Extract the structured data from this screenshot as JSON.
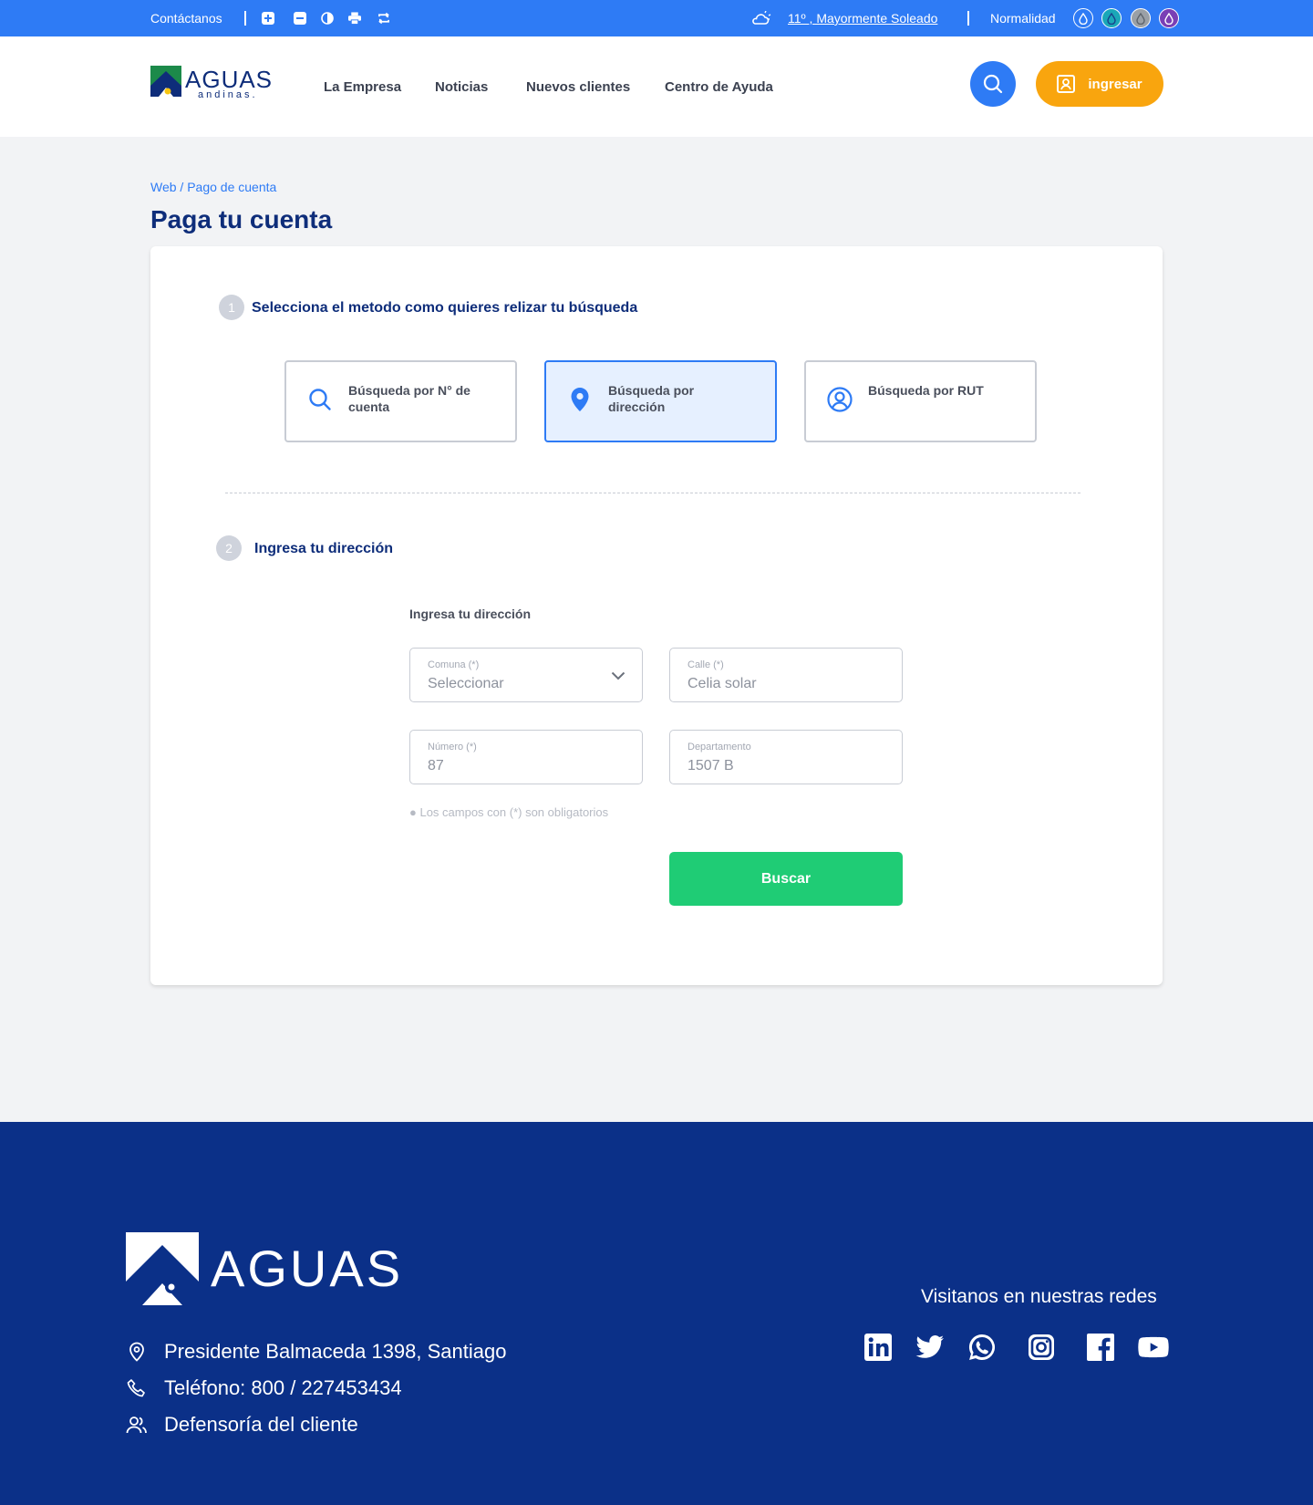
{
  "topbar": {
    "contact": "Contáctanos",
    "weather": "11º , Mayormente Soleado",
    "status": "Normalidad",
    "drop_colors": [
      "#2e7bf5",
      "#1aa7b8",
      "#9aa0a6",
      "#7a3fb5"
    ]
  },
  "brand": {
    "name": "AGUAS",
    "sub": "andinas."
  },
  "nav": {
    "items": [
      "La Empresa",
      "Noticias",
      "Nuevos clientes",
      "Centro de Ayuda"
    ],
    "login": "ingresar"
  },
  "breadcrumb": "Web / Pago de cuenta",
  "page_title": "Paga tu cuenta",
  "step1": {
    "num": "1",
    "title": "Selecciona el metodo como quieres relizar tu búsqueda",
    "options": [
      {
        "label": "Búsqueda por N° de cuenta",
        "icon": "search-icon",
        "selected": false
      },
      {
        "label": "Búsqueda por dirección",
        "icon": "location-pin-icon",
        "selected": true
      },
      {
        "label": "Búsqueda por RUT",
        "icon": "user-circle-icon",
        "selected": false
      }
    ]
  },
  "step2": {
    "num": "2",
    "title": "Ingresa tu dirección",
    "form_title": "Ingresa tu dirección",
    "fields": {
      "comuna": {
        "label": "Comuna (*)",
        "value": "Seleccionar"
      },
      "calle": {
        "label": "Calle (*)",
        "value": "Celia solar"
      },
      "numero": {
        "label": "Número (*)",
        "value": "87"
      },
      "departamento": {
        "label": "Departamento",
        "value": "1507 B"
      }
    },
    "note": "● Los campos con (*) son obligatorios",
    "button": "Buscar"
  },
  "footer": {
    "logo_word": "AGUAS",
    "address": "Presidente Balmaceda 1398, Santiago",
    "phone": "Teléfono: 800 / 227453434",
    "defense": "Defensoría del cliente",
    "social_title": "Visitanos en nuestras redes",
    "social": [
      "linkedin-icon",
      "twitter-icon",
      "whatsapp-icon",
      "instagram-icon",
      "facebook-icon",
      "youtube-icon"
    ]
  },
  "colors": {
    "primary": "#2e7bf5",
    "navy": "#0b3088",
    "accent": "#f9a50e",
    "success": "#1fcc75"
  }
}
